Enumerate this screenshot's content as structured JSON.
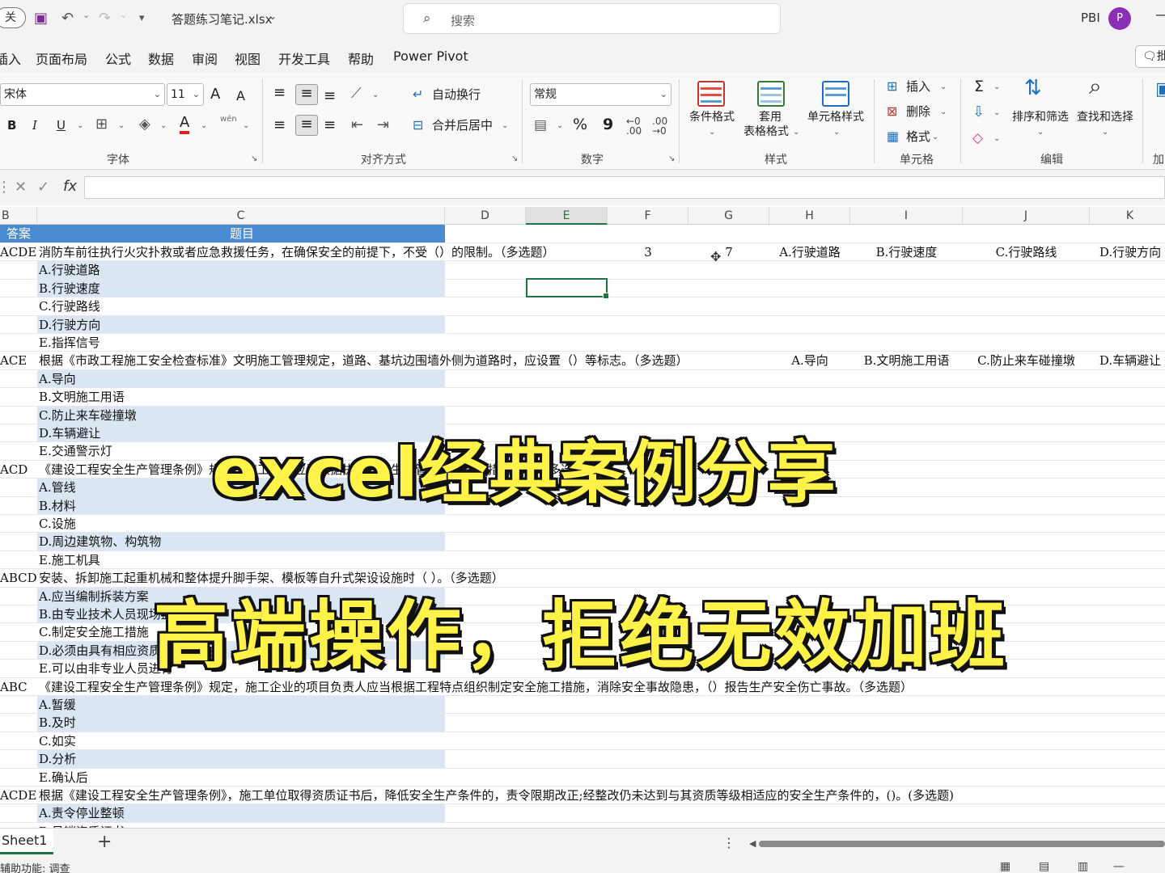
{
  "titlebar": {
    "autosave_toggle": "关",
    "filename": "答题练习笔记.xlsx",
    "search_placeholder": "搜索",
    "user": "PBI",
    "avatar_letter": "P"
  },
  "menu": {
    "tabs": [
      "插入",
      "页面布局",
      "公式",
      "数据",
      "审阅",
      "视图",
      "开发工具",
      "帮助",
      "Power Pivot"
    ],
    "comment_label": "批"
  },
  "ribbon": {
    "font_name": "宋体",
    "font_size": "11",
    "grow_font": "A",
    "shrink_font": "A",
    "bold": "B",
    "italic": "I",
    "underline": "U",
    "pinyin": "wén",
    "wrap_text": "自动换行",
    "merge_center": "合并后居中",
    "number_format": "常规",
    "percent": "%",
    "comma": "9",
    "conditional_format": "条件格式",
    "table_format_line1": "套用",
    "table_format_line2": "表格格式",
    "cell_styles": "单元格样式",
    "insert": "插入",
    "delete": "删除",
    "format": "格式",
    "sort_filter": "排序和筛选",
    "find_select": "查找和选择",
    "groups": {
      "font": "字体",
      "alignment": "对齐方式",
      "number": "数字",
      "styles": "样式",
      "cells": "单元格",
      "editing": "编辑",
      "addins": "加"
    }
  },
  "formula_bar": {
    "fx": "fx",
    "value": ""
  },
  "columns": [
    "B",
    "C",
    "D",
    "E",
    "F",
    "G",
    "H",
    "I",
    "J",
    "K"
  ],
  "selected_column": "E",
  "header_row": {
    "b": "答案",
    "c": "题目"
  },
  "rows": [
    {
      "b": "ACDE",
      "c": "消防车前往执行火灾扑救或者应急救援任务，在确保安全的前提下，不受（）的限制。（多选题）",
      "blue": false
    },
    {
      "b": "",
      "c": "A.行驶道路",
      "blue": true
    },
    {
      "b": "",
      "c": "B.行驶速度",
      "blue": true
    },
    {
      "b": "",
      "c": "C.行驶路线",
      "blue": false
    },
    {
      "b": "",
      "c": "D.行驶方向",
      "blue": true
    },
    {
      "b": "",
      "c": "E.指挥信号",
      "blue": false
    },
    {
      "b": "ACE",
      "c": "根据《市政工程施工安全检查标准》文明施工管理规定，道路、基坑边围墙外侧为道路时，应设置（）等标志。（多选题）",
      "blue": false
    },
    {
      "b": "",
      "c": "A.导向",
      "blue": true
    },
    {
      "b": "",
      "c": "B.文明施工用语",
      "blue": false
    },
    {
      "b": "",
      "c": "C.防止来车碰撞墩",
      "blue": true
    },
    {
      "b": "",
      "c": "D.车辆避让",
      "blue": true
    },
    {
      "b": "",
      "c": "E.交通警示灯",
      "blue": false
    },
    {
      "b": "ACD",
      "c": "《建设工程安全生产管理条例》规定，施工单位应当根据执行安全生产管理规定采取措施……（多选题）",
      "blue": false
    },
    {
      "b": "",
      "c": "A.管线",
      "blue": true
    },
    {
      "b": "",
      "c": "B.材料",
      "blue": true
    },
    {
      "b": "",
      "c": "C.设施",
      "blue": false
    },
    {
      "b": "",
      "c": "D.周边建筑物、构筑物",
      "blue": true
    },
    {
      "b": "",
      "c": "E.施工机具",
      "blue": false
    },
    {
      "b": "ABCD",
      "c": "安装、拆卸施工起重机械和整体提升脚手架、模板等自升式架设设施时（ ）。（多选题）",
      "blue": false
    },
    {
      "b": "",
      "c": "A.应当编制拆装方案",
      "blue": true
    },
    {
      "b": "",
      "c": "B.由专业技术人员现场监督",
      "blue": true
    },
    {
      "b": "",
      "c": "C.制定安全施工措施",
      "blue": false
    },
    {
      "b": "",
      "c": "D.必须由具有相应资质的单位承担",
      "blue": true
    },
    {
      "b": "",
      "c": "E.可以由非专业人员进行",
      "blue": false
    },
    {
      "b": "ABC",
      "c": "《建设工程安全生产管理条例》规定，施工企业的项目负责人应当根据工程特点组织制定安全施工措施，消除安全事故隐患，（）报告生产安全伤亡事故。（多选题）",
      "blue": false
    },
    {
      "b": "",
      "c": "A.暂缓",
      "blue": true
    },
    {
      "b": "",
      "c": "B.及时",
      "blue": true
    },
    {
      "b": "",
      "c": "C.如实",
      "blue": false
    },
    {
      "b": "",
      "c": "D.分析",
      "blue": true
    },
    {
      "b": "",
      "c": "E.确认后",
      "blue": false
    },
    {
      "b": "ACDE",
      "c": "根据《建设工程安全生产管理条例》，施工单位取得资质证书后，降低安全生产条件的，责令限期改正;经整改仍未达到与其资质等级相适应的安全生产条件的，()。(多选题)",
      "blue": false
    },
    {
      "b": "",
      "c": "A.责令停业整顿",
      "blue": true
    },
    {
      "b": "",
      "c": "B.吊销资质证书",
      "blue": false
    }
  ],
  "row1_values": {
    "f": "3",
    "g": "7",
    "h": "A.行驶道路",
    "i": "B.行驶速度",
    "j": "C.行驶路线",
    "k": "D.行驶方向"
  },
  "row7_values": {
    "h": "A.导向",
    "i": "B.文明施工用语",
    "j": "C.防止来车碰撞墩",
    "k": "D.车辆避让"
  },
  "captions": {
    "line1": "excel经典案例分享",
    "line2": "高端操作，拒绝无效加班"
  },
  "sheets": {
    "active": "Sheet1",
    "add": "+",
    "more": "⋮"
  },
  "status": {
    "accessibility": "辅助功能: 调查"
  }
}
